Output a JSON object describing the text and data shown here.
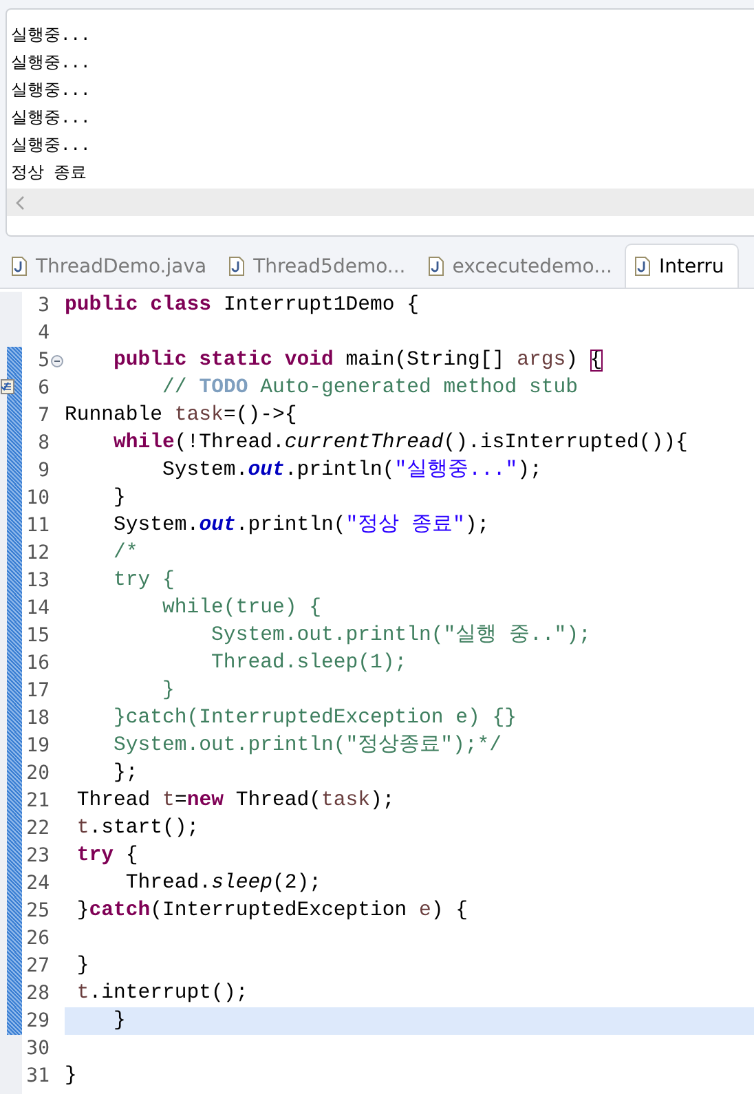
{
  "console": {
    "lines": [
      "실행중...",
      "실행중...",
      "실행중...",
      "실행중...",
      "실행중...",
      "정상 종료"
    ]
  },
  "tabs": [
    {
      "label": "ThreadDemo.java",
      "selected": false
    },
    {
      "label": "Thread5demo...",
      "selected": false
    },
    {
      "label": "excecutedemo...",
      "selected": false
    },
    {
      "label": "Interru",
      "selected": true
    }
  ],
  "editor": {
    "lines": [
      {
        "number": "3",
        "changed": false,
        "current": false,
        "segments": [
          {
            "kind": "kw",
            "text": "public class"
          },
          {
            "kind": "plain",
            "text": " Interrupt1Demo {"
          }
        ]
      },
      {
        "number": "4",
        "changed": false,
        "current": false
      },
      {
        "number": "5",
        "changed": true,
        "current": false,
        "kind": "fold",
        "segments": [
          {
            "kind": "kw",
            "text": "    public static void"
          },
          {
            "kind": "plain",
            "text": " main(String[] "
          },
          {
            "kind": "var",
            "text": "args"
          },
          {
            "kind": "plain",
            "text": ") "
          },
          {
            "kind": "bracket",
            "text": "{"
          }
        ]
      },
      {
        "number": "6",
        "changed": true,
        "current": false,
        "kind": "task",
        "segments": [
          {
            "kind": "comment",
            "text": "        // "
          },
          {
            "kind": "todo",
            "text": "TODO"
          },
          {
            "kind": "comment",
            "text": " Auto-generated method stub"
          }
        ]
      },
      {
        "number": "7",
        "changed": true,
        "current": false,
        "segments": [
          {
            "kind": "plain",
            "text": "Runnable "
          },
          {
            "kind": "var",
            "text": "task"
          },
          {
            "kind": "plain",
            "text": "=()->{"
          }
        ]
      },
      {
        "number": "8",
        "changed": true,
        "current": false,
        "segments": [
          {
            "kind": "kw",
            "text": "    while"
          },
          {
            "kind": "plain",
            "text": "(!Thread."
          },
          {
            "kind": "static",
            "text": "currentThread"
          },
          {
            "kind": "plain",
            "text": "().isInterrupted()){"
          }
        ]
      },
      {
        "number": "9",
        "changed": true,
        "current": false,
        "segments": [
          {
            "kind": "plain",
            "text": "        System."
          },
          {
            "kind": "field",
            "text": "out"
          },
          {
            "kind": "plain",
            "text": ".println("
          },
          {
            "kind": "string",
            "text": "\"실행중...\""
          },
          {
            "kind": "plain",
            "text": ");"
          }
        ]
      },
      {
        "number": "10",
        "changed": true,
        "current": false,
        "segments": [
          {
            "kind": "plain",
            "text": "    }"
          }
        ]
      },
      {
        "number": "11",
        "changed": true,
        "current": false,
        "segments": [
          {
            "kind": "plain",
            "text": "    System."
          },
          {
            "kind": "field",
            "text": "out"
          },
          {
            "kind": "plain",
            "text": ".println("
          },
          {
            "kind": "string",
            "text": "\"정상 종료\""
          },
          {
            "kind": "plain",
            "text": ");"
          }
        ]
      },
      {
        "number": "12",
        "changed": true,
        "current": false,
        "segments": [
          {
            "kind": "comment",
            "text": "    /*"
          }
        ]
      },
      {
        "number": "13",
        "changed": true,
        "current": false,
        "segments": [
          {
            "kind": "comment",
            "text": "    try {"
          }
        ]
      },
      {
        "number": "14",
        "changed": true,
        "current": false,
        "segments": [
          {
            "kind": "comment",
            "text": "        while(true) {"
          }
        ]
      },
      {
        "number": "15",
        "changed": true,
        "current": false,
        "segments": [
          {
            "kind": "comment",
            "text": "            System.out.println(\"실행 중..\");"
          }
        ]
      },
      {
        "number": "16",
        "changed": true,
        "current": false,
        "segments": [
          {
            "kind": "comment",
            "text": "            Thread.sleep(1);"
          }
        ]
      },
      {
        "number": "17",
        "changed": true,
        "current": false,
        "segments": [
          {
            "kind": "comment",
            "text": "        }"
          }
        ]
      },
      {
        "number": "18",
        "changed": true,
        "current": false,
        "segments": [
          {
            "kind": "comment",
            "text": "    }catch(InterruptedException e) {}"
          }
        ]
      },
      {
        "number": "19",
        "changed": true,
        "current": false,
        "segments": [
          {
            "kind": "comment",
            "text": "    System.out.println(\"정상종료\");*/"
          }
        ]
      },
      {
        "number": "20",
        "changed": true,
        "current": false,
        "segments": [
          {
            "kind": "plain",
            "text": "    };"
          }
        ]
      },
      {
        "number": "21",
        "changed": true,
        "current": false,
        "segments": [
          {
            "kind": "plain",
            "text": " Thread "
          },
          {
            "kind": "var",
            "text": "t"
          },
          {
            "kind": "plain",
            "text": "="
          },
          {
            "kind": "kw",
            "text": "new"
          },
          {
            "kind": "plain",
            "text": " Thread("
          },
          {
            "kind": "var",
            "text": "task"
          },
          {
            "kind": "plain",
            "text": ");"
          }
        ]
      },
      {
        "number": "22",
        "changed": true,
        "current": false,
        "segments": [
          {
            "kind": "var",
            "text": " t"
          },
          {
            "kind": "plain",
            "text": ".start();"
          }
        ]
      },
      {
        "number": "23",
        "changed": true,
        "current": false,
        "segments": [
          {
            "kind": "kw",
            "text": " try"
          },
          {
            "kind": "plain",
            "text": " {"
          }
        ]
      },
      {
        "number": "24",
        "changed": true,
        "current": false,
        "segments": [
          {
            "kind": "plain",
            "text": "     Thread."
          },
          {
            "kind": "static",
            "text": "sleep"
          },
          {
            "kind": "plain",
            "text": "(2);"
          }
        ]
      },
      {
        "number": "25",
        "changed": true,
        "current": false,
        "segments": [
          {
            "kind": "plain",
            "text": " }"
          },
          {
            "kind": "kw",
            "text": "catch"
          },
          {
            "kind": "plain",
            "text": "(InterruptedException "
          },
          {
            "kind": "var",
            "text": "e"
          },
          {
            "kind": "plain",
            "text": ") {"
          }
        ]
      },
      {
        "number": "26",
        "changed": true,
        "current": false
      },
      {
        "number": "27",
        "changed": true,
        "current": false,
        "segments": [
          {
            "kind": "plain",
            "text": " }"
          }
        ]
      },
      {
        "number": "28",
        "changed": true,
        "current": false,
        "segments": [
          {
            "kind": "var",
            "text": " t"
          },
          {
            "kind": "plain",
            "text": ".interrupt();"
          }
        ]
      },
      {
        "number": "29",
        "changed": true,
        "current": true,
        "segments": [
          {
            "kind": "plain",
            "text": "    }"
          }
        ]
      },
      {
        "number": "30",
        "changed": false,
        "current": false
      },
      {
        "number": "31",
        "changed": false,
        "current": false,
        "segments": [
          {
            "kind": "plain",
            "text": "}"
          }
        ]
      }
    ]
  }
}
